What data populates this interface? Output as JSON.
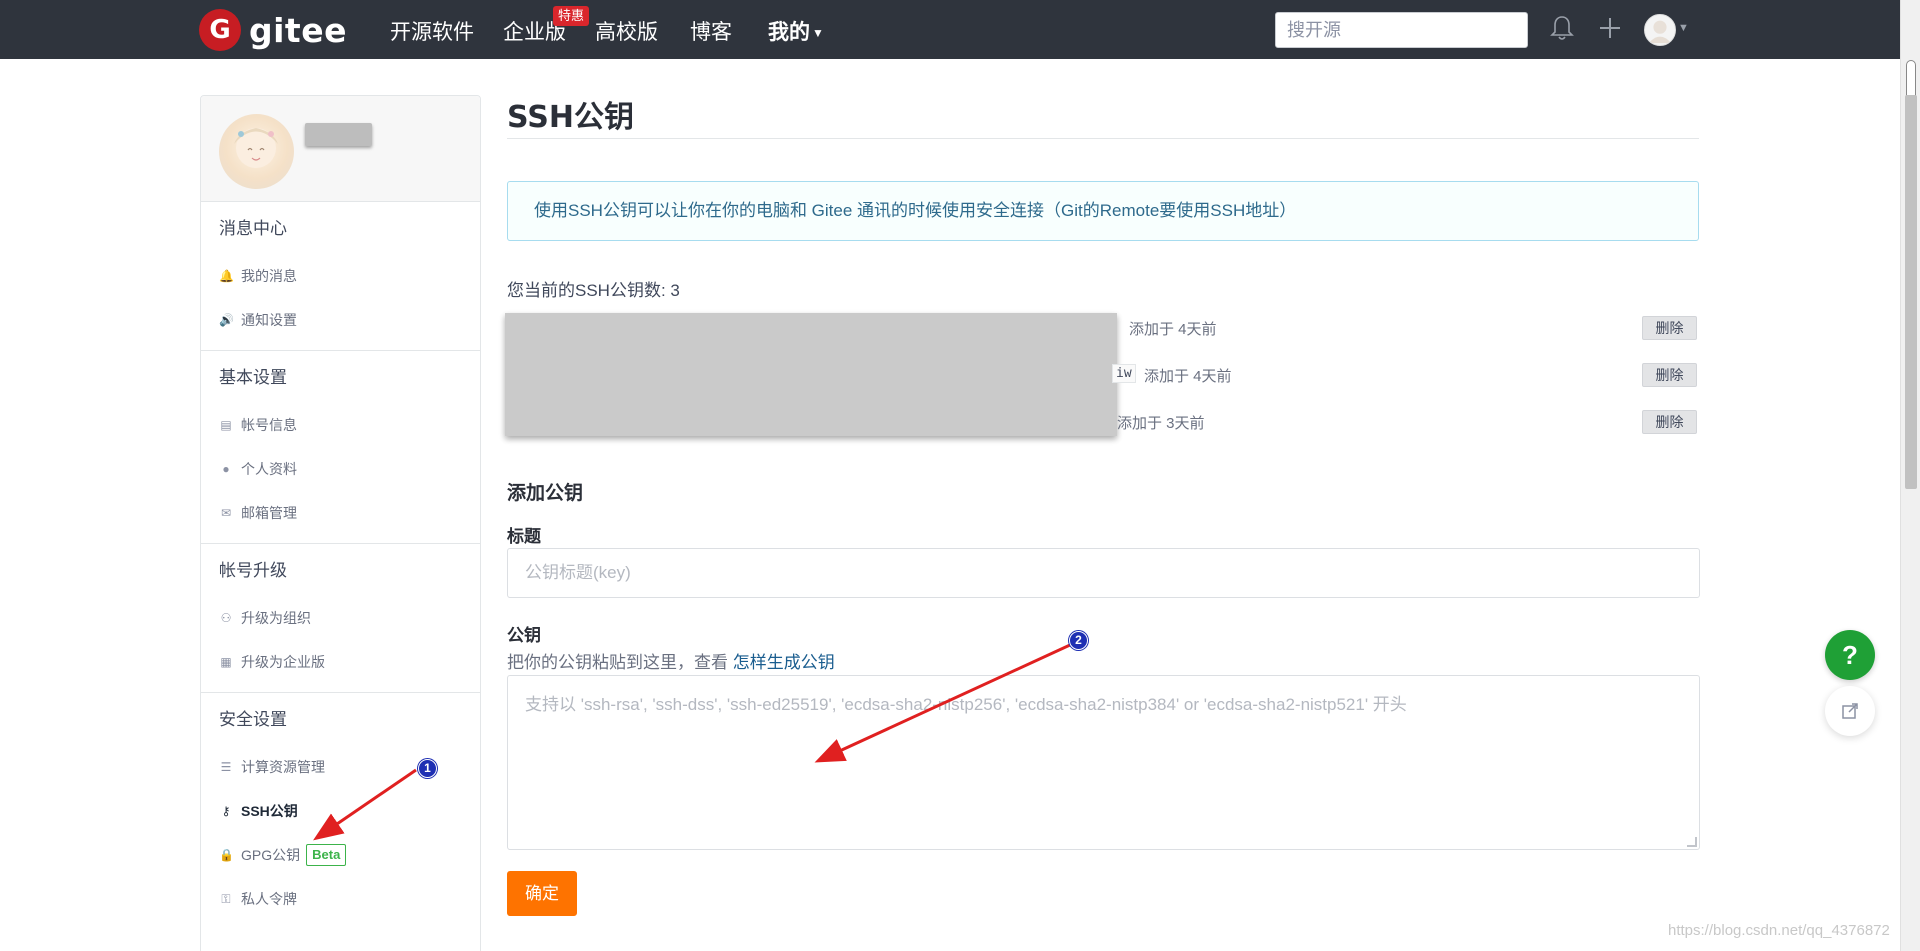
{
  "nav": {
    "logo_mark": "G",
    "logo_text": "gitee",
    "items": [
      "开源软件",
      "企业版",
      "高校版",
      "博客",
      "我的"
    ],
    "badge": "特惠",
    "search_placeholder": "搜开源"
  },
  "sidebar": {
    "sections": [
      {
        "title": "消息中心",
        "items": [
          {
            "label": "我的消息",
            "icon": "bell-icon"
          },
          {
            "label": "通知设置",
            "icon": "speaker-icon"
          }
        ]
      },
      {
        "title": "基本设置",
        "items": [
          {
            "label": "帐号信息",
            "icon": "id-card-icon"
          },
          {
            "label": "个人资料",
            "icon": "user-icon"
          },
          {
            "label": "邮箱管理",
            "icon": "mail-icon"
          }
        ]
      },
      {
        "title": "帐号升级",
        "items": [
          {
            "label": "升级为组织",
            "icon": "group-icon"
          },
          {
            "label": "升级为企业版",
            "icon": "building-icon"
          }
        ]
      },
      {
        "title": "安全设置",
        "items": [
          {
            "label": "计算资源管理",
            "icon": "server-icon"
          },
          {
            "label": "SSH公钥",
            "icon": "key-icon"
          },
          {
            "label": "GPG公钥",
            "icon": "lock-icon",
            "badge": "Beta"
          },
          {
            "label": "私人令牌",
            "icon": "token-icon"
          }
        ]
      }
    ]
  },
  "main": {
    "title": "SSH公钥",
    "info": "使用SSH公钥可以让你在你的电脑和 Gitee 通讯的时候使用安全连接（Git的Remote要使用SSH地址）",
    "count_label": "您当前的SSH公钥数: 3",
    "keys": [
      {
        "added": "添加于 4天前",
        "tail": "",
        "delete": "删除"
      },
      {
        "added": "添加于 4天前",
        "tail": "iw",
        "delete": "删除"
      },
      {
        "added": "添加于 3天前",
        "tail": "",
        "delete": "删除"
      }
    ],
    "add_title": "添加公钥",
    "title_label": "标题",
    "title_placeholder": "公钥标题(key)",
    "key_label": "公钥",
    "hint_prefix": "把你的公钥粘贴到这里，查看 ",
    "hint_link": "怎样生成公钥",
    "key_placeholder": "支持以 'ssh-rsa', 'ssh-dss', 'ssh-ed25519', 'ecdsa-sha2-nistp256', 'ecdsa-sha2-nistp384' or 'ecdsa-sha2-nistp521' 开头",
    "confirm": "确定"
  },
  "fab": {
    "help": "?"
  },
  "annotations": [
    "1",
    "2"
  ],
  "watermark": "https://blog.csdn.net/qq_4376872",
  "colors": {
    "nav_bg": "#2f343d",
    "brand_red": "#c71d23",
    "confirm_orange": "#fe7300",
    "help_green": "#1fa036",
    "arrow_red": "#e02020",
    "badge_blue": "#1e2fb3"
  }
}
